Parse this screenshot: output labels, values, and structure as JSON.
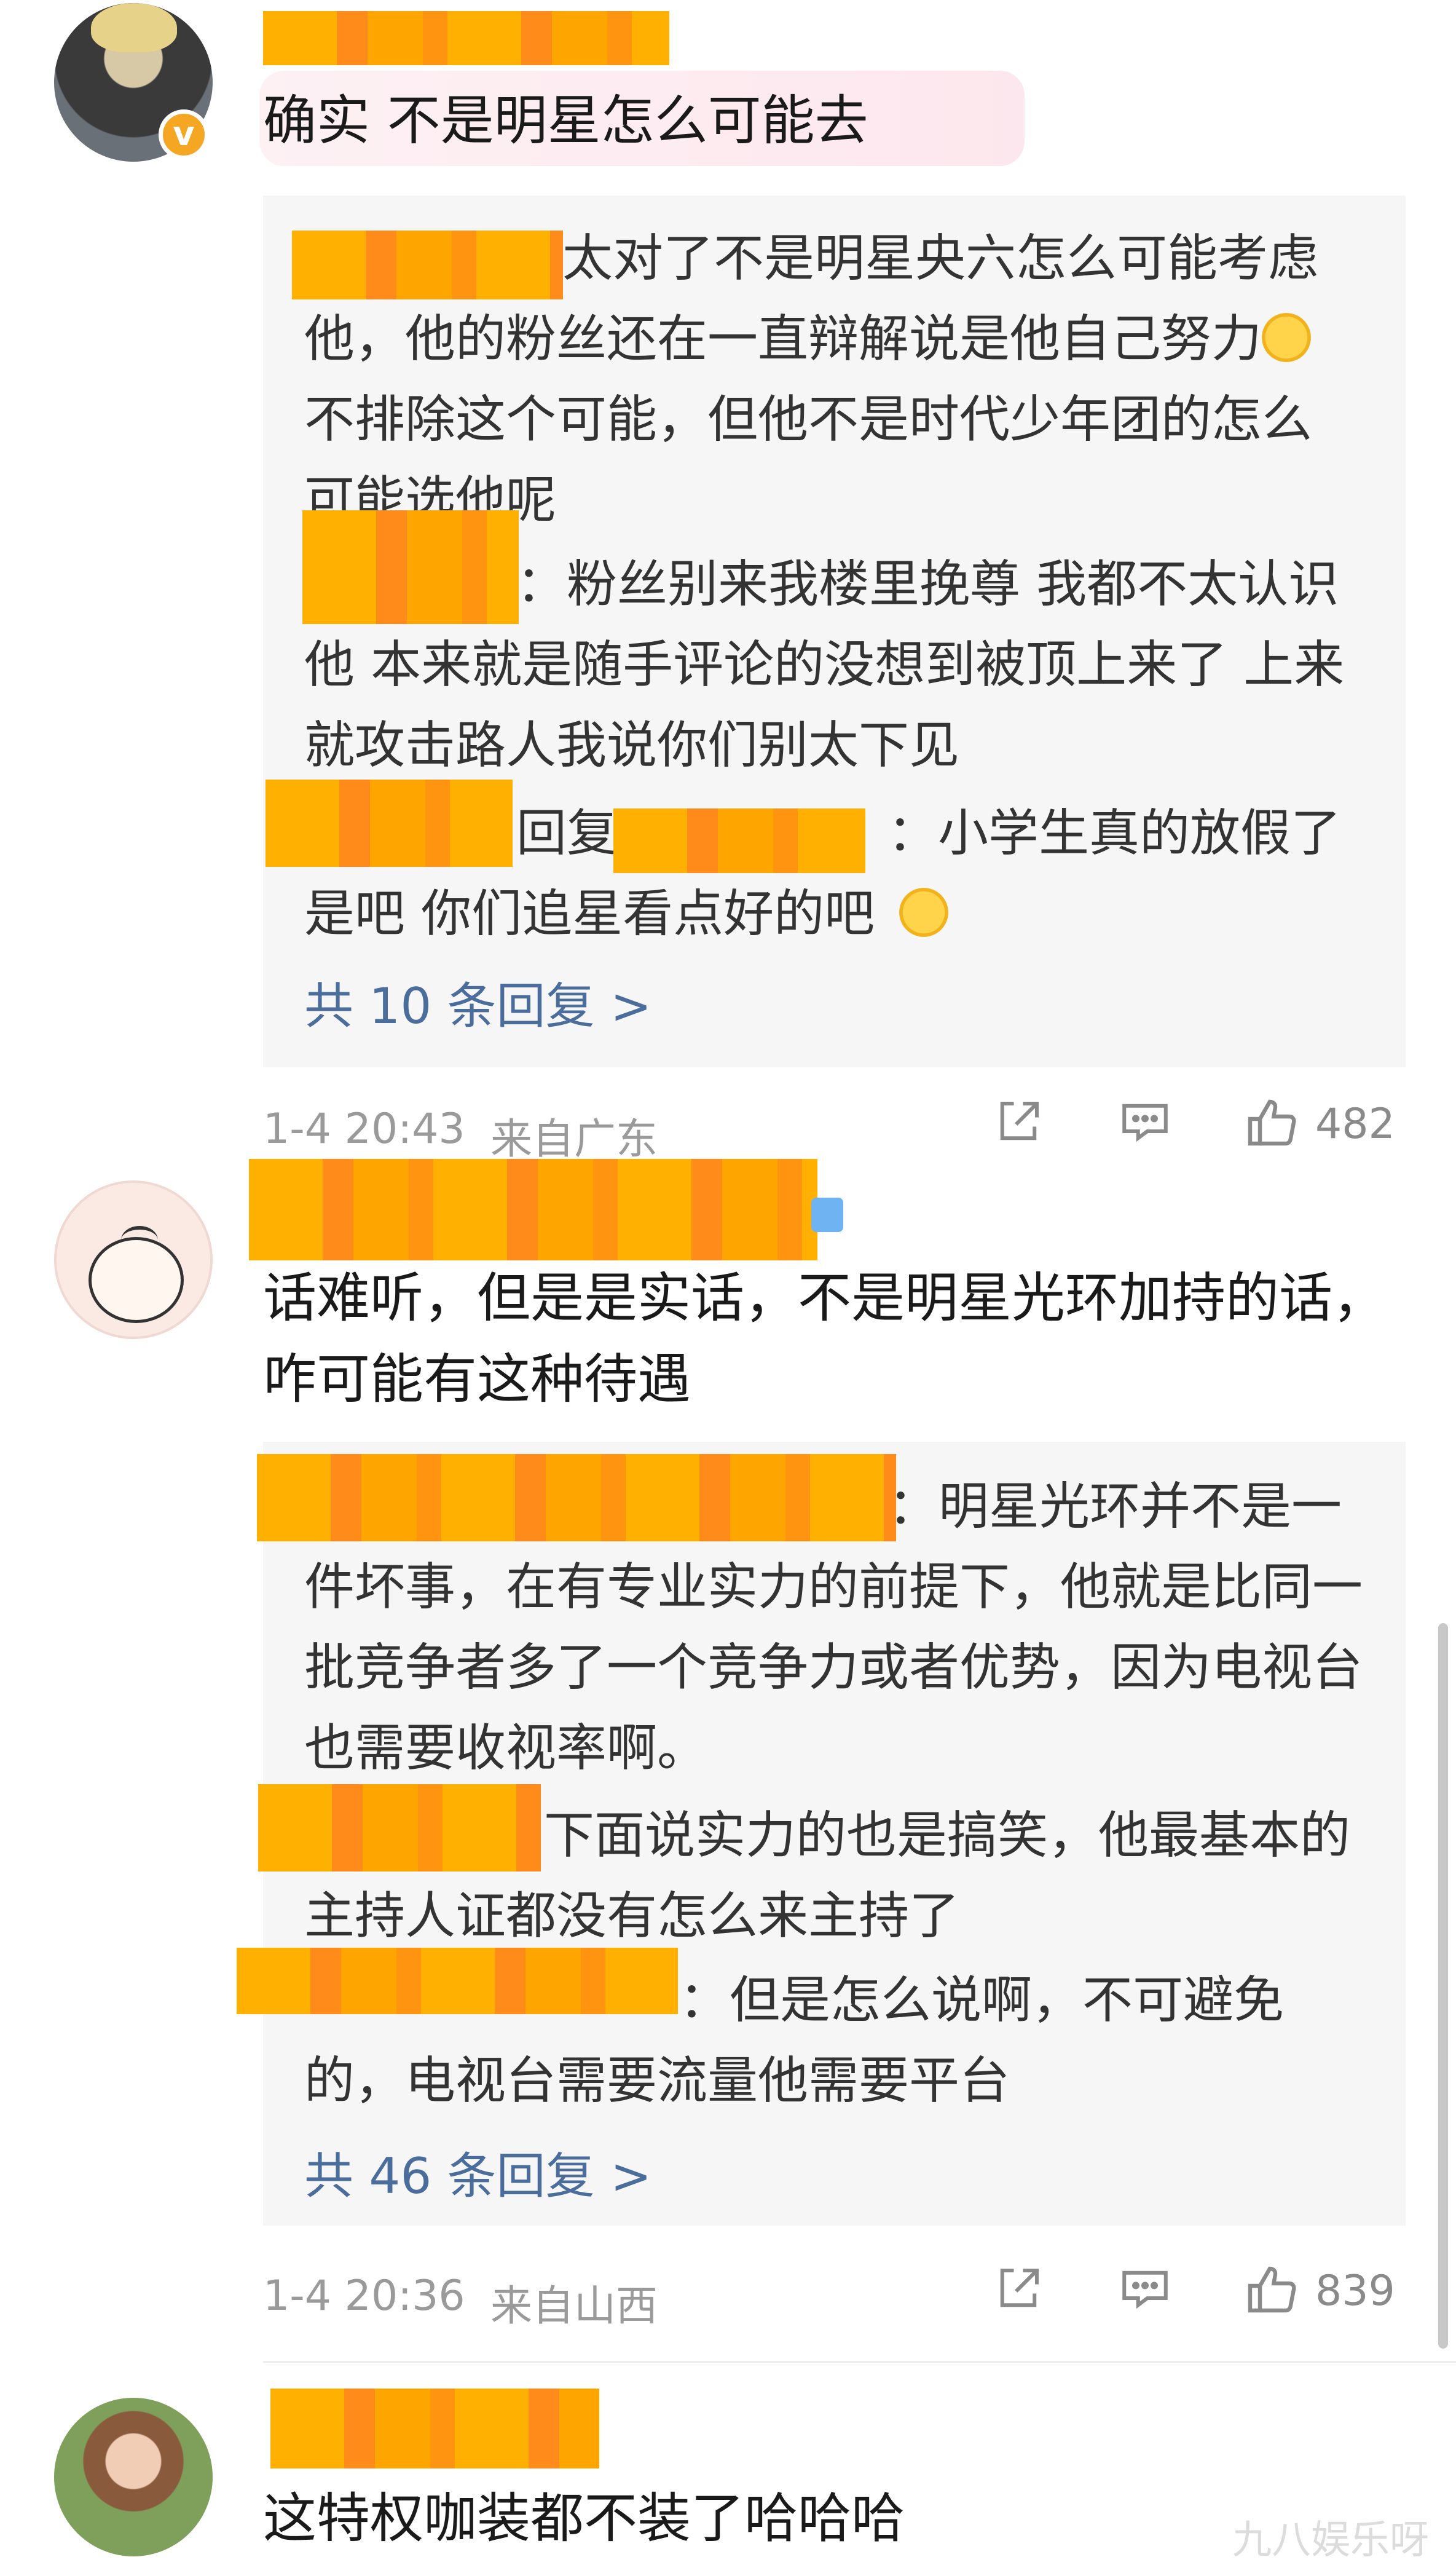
{
  "comments": [
    {
      "text": "确实 不是明星怎么可能去",
      "replies": [
        "太对了不是明星央六怎么可能考虑他，他的粉丝还在一直辩解说是他自己努力",
        "不排除这个可能，但他不是时代少年团的怎么可能选他呢",
        "：粉丝别来我楼里挽尊 我都不太认识他 本来就是随手评论的没想到被顶上来了 上来就攻击路人我说你们别太下见",
        "回复",
        "：小学生真的放假了是吧 你们追星看点好的吧"
      ],
      "more": "共 10 条回复 >",
      "time": "1-4 20:43",
      "location": "来自广东",
      "likes": "482"
    },
    {
      "text": "话难听，但是是实话，不是明星光环加持的话，咋可能有这种待遇",
      "replies": [
        "：明星光环并不是一件坏事，在有专业实力的前提下，他就是比同一批竞争者多了一个竞争力或者优势，因为电视台也需要收视率啊。",
        "下面说实力的也是搞笑，他最基本的主持人证都没有怎么来主持了",
        "：但是怎么说啊，不可避免的，电视台需要流量他需要平台"
      ],
      "more": "共 46 条回复 >",
      "time": "1-4 20:36",
      "location": "来自山西",
      "likes": "839"
    },
    {
      "text": "这特权咖装都不装了哈哈哈"
    }
  ],
  "watermark": "九八娱乐呀",
  "icons": {
    "share": "share-icon",
    "comment": "comment-icon",
    "like": "like-thumb-icon",
    "verified": "verified-badge-icon",
    "emoji_cry": "laugh-cry-emoji-icon",
    "emoji_laugh": "laugh-emoji-icon"
  },
  "colors": {
    "link": "#4a6d9c",
    "meta": "#9a9a9a",
    "reply_bg": "#f6f6f6",
    "verified": "#f5a623",
    "redaction": "#ffb000"
  }
}
